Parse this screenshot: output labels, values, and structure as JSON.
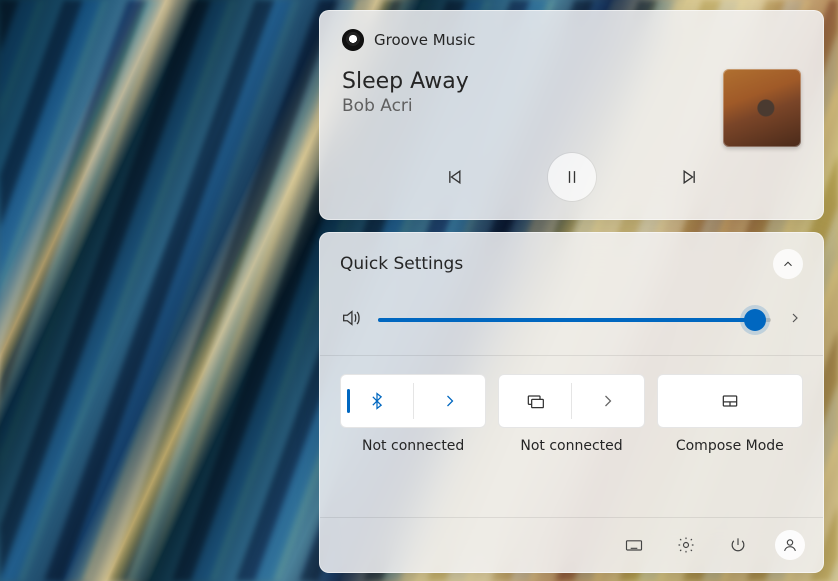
{
  "media": {
    "app_name": "Groove Music",
    "track_title": "Sleep Away",
    "artist": "Bob Acri",
    "is_playing": true
  },
  "quick_settings": {
    "title": "Quick Settings",
    "volume": {
      "level_percent": 96
    },
    "tiles": [
      {
        "id": "bluetooth",
        "label": "Not connected",
        "active": true,
        "has_sub": true,
        "icon": "bluetooth-icon"
      },
      {
        "id": "cast",
        "label": "Not connected",
        "active": false,
        "has_sub": true,
        "icon": "cast-icon"
      },
      {
        "id": "compose",
        "label": "Compose Mode",
        "active": false,
        "has_sub": false,
        "icon": "compose-icon"
      }
    ],
    "footer_icons": [
      "keyboard-icon",
      "settings-icon",
      "power-icon",
      "user-icon"
    ]
  }
}
